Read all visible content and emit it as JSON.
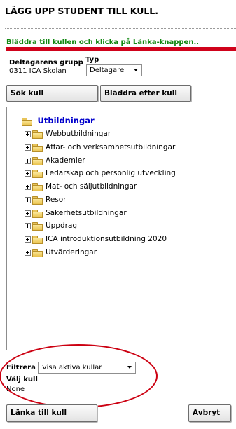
{
  "header": {
    "title": "LÄGG UPP STUDENT TILL KULL.",
    "instruction": "Bläddra till kullen och klicka på Länka-knappen..",
    "accent_color": "#d0021b",
    "instruction_color": "#118811"
  },
  "form": {
    "group_label": "Deltagarens grupp",
    "group_value": "0311 ICA Skolan",
    "type_label": "Typ",
    "type_value": "Deltagare"
  },
  "toolbar": {
    "search_label": "Sök kull",
    "browse_label": "Bläddra efter kull"
  },
  "tree": {
    "root_label": "Utbildningar",
    "items": [
      {
        "label": "Webbutbildningar"
      },
      {
        "label": "Affär- och verksamhetsutbildningar"
      },
      {
        "label": "Akademier"
      },
      {
        "label": "Ledarskap och personlig utveckling"
      },
      {
        "label": "Mat- och säljutbildningar"
      },
      {
        "label": "Resor"
      },
      {
        "label": "Säkerhetsutbildningar"
      },
      {
        "label": "Uppdrag"
      },
      {
        "label": "ICA introduktionsutbildning 2020"
      },
      {
        "label": "Utvärderingar"
      }
    ],
    "icons": {
      "expand": "plus-icon",
      "folder": "folder-icon"
    }
  },
  "filter": {
    "label": "Filtrera",
    "value": "Visa aktiva kullar",
    "highlight_color": "#cc0011"
  },
  "selection": {
    "label": "Välj kull",
    "value": "None"
  },
  "footer": {
    "link_label": "Länka till kull",
    "cancel_label": "Avbryt"
  }
}
